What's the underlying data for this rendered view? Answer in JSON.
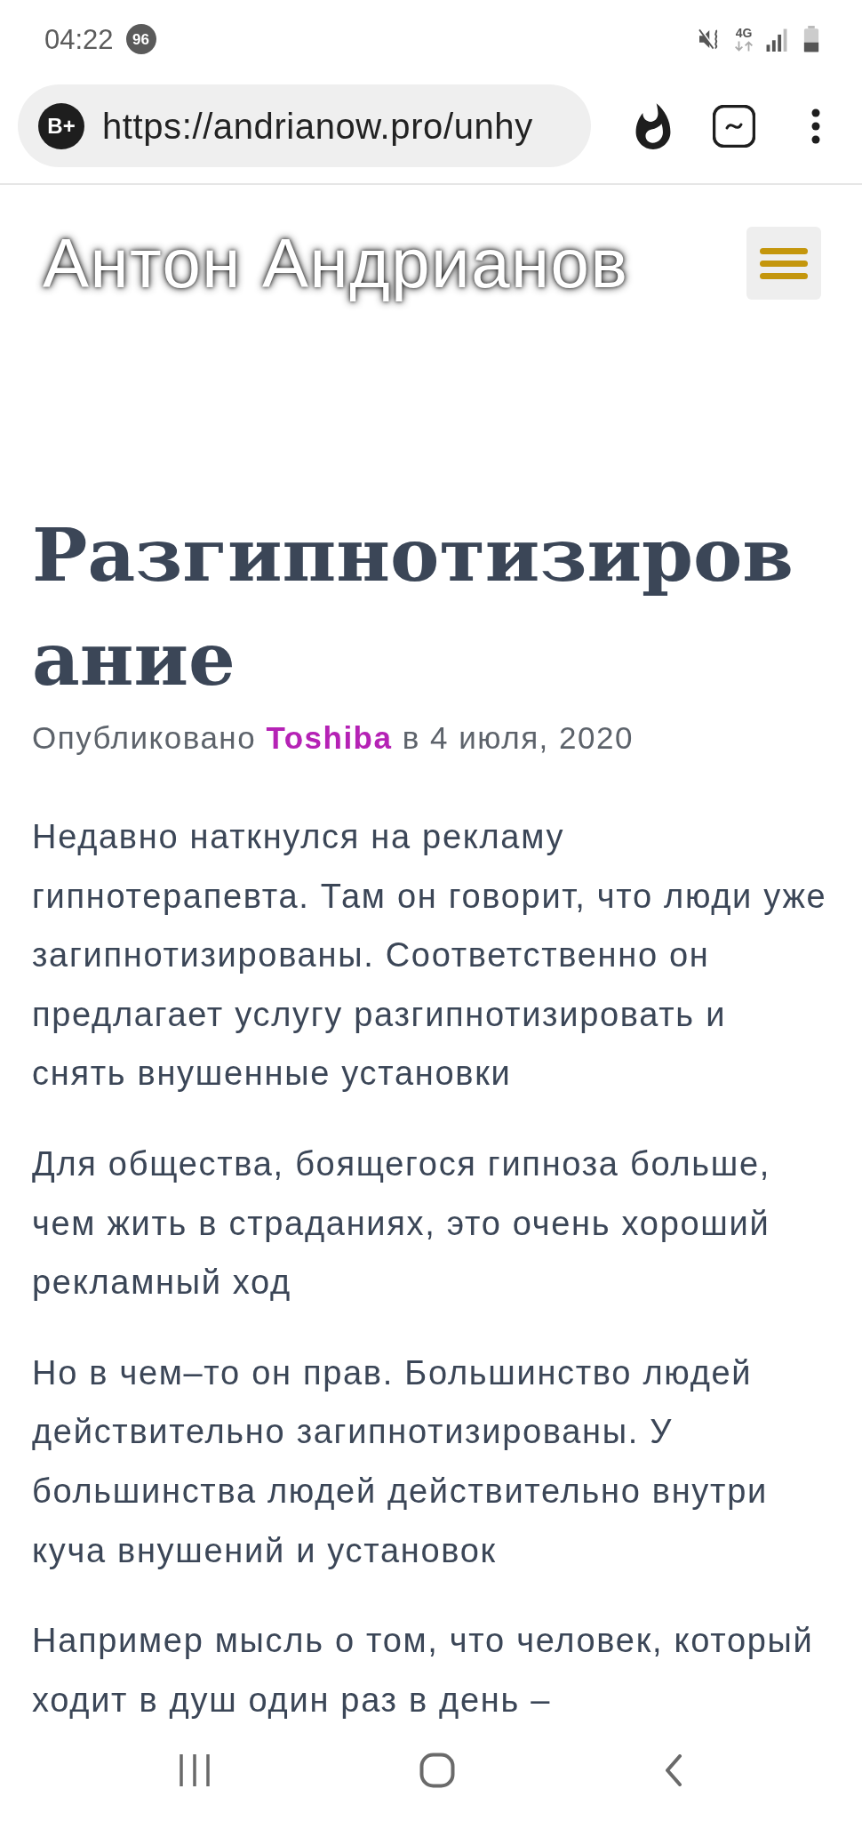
{
  "status_bar": {
    "time": "04:22",
    "notification_count": "96",
    "network_type": "4G"
  },
  "browser_toolbar": {
    "site_badge": "B+",
    "url": "https://andrianow.pro/unhy"
  },
  "site_header": {
    "title": "Антон Андрианов"
  },
  "post": {
    "title": "Разгипнотизирование",
    "byline": {
      "prefix": "Опубликовано",
      "author": "Toshiba",
      "date": "в 4 июля, 2020"
    },
    "paragraphs": [
      "Недавно наткнулся на рекламу гипнотерапевта. Там он говорит, что люди уже загипнотизированы. Соответственно он предлагает услугу разгипнотизировать и снять внушенные установки",
      "Для общества, боящегося гипноза больше, чем жить в страданиях, это очень хороший рекламный ход",
      "Но в чем–то он прав. Большинство людей действительно загипнотизированы. У большинства людей действительно внутри куча внушений и установок",
      "Например мысль о том, что человек, который ходит в душ один раз в день –"
    ]
  }
}
